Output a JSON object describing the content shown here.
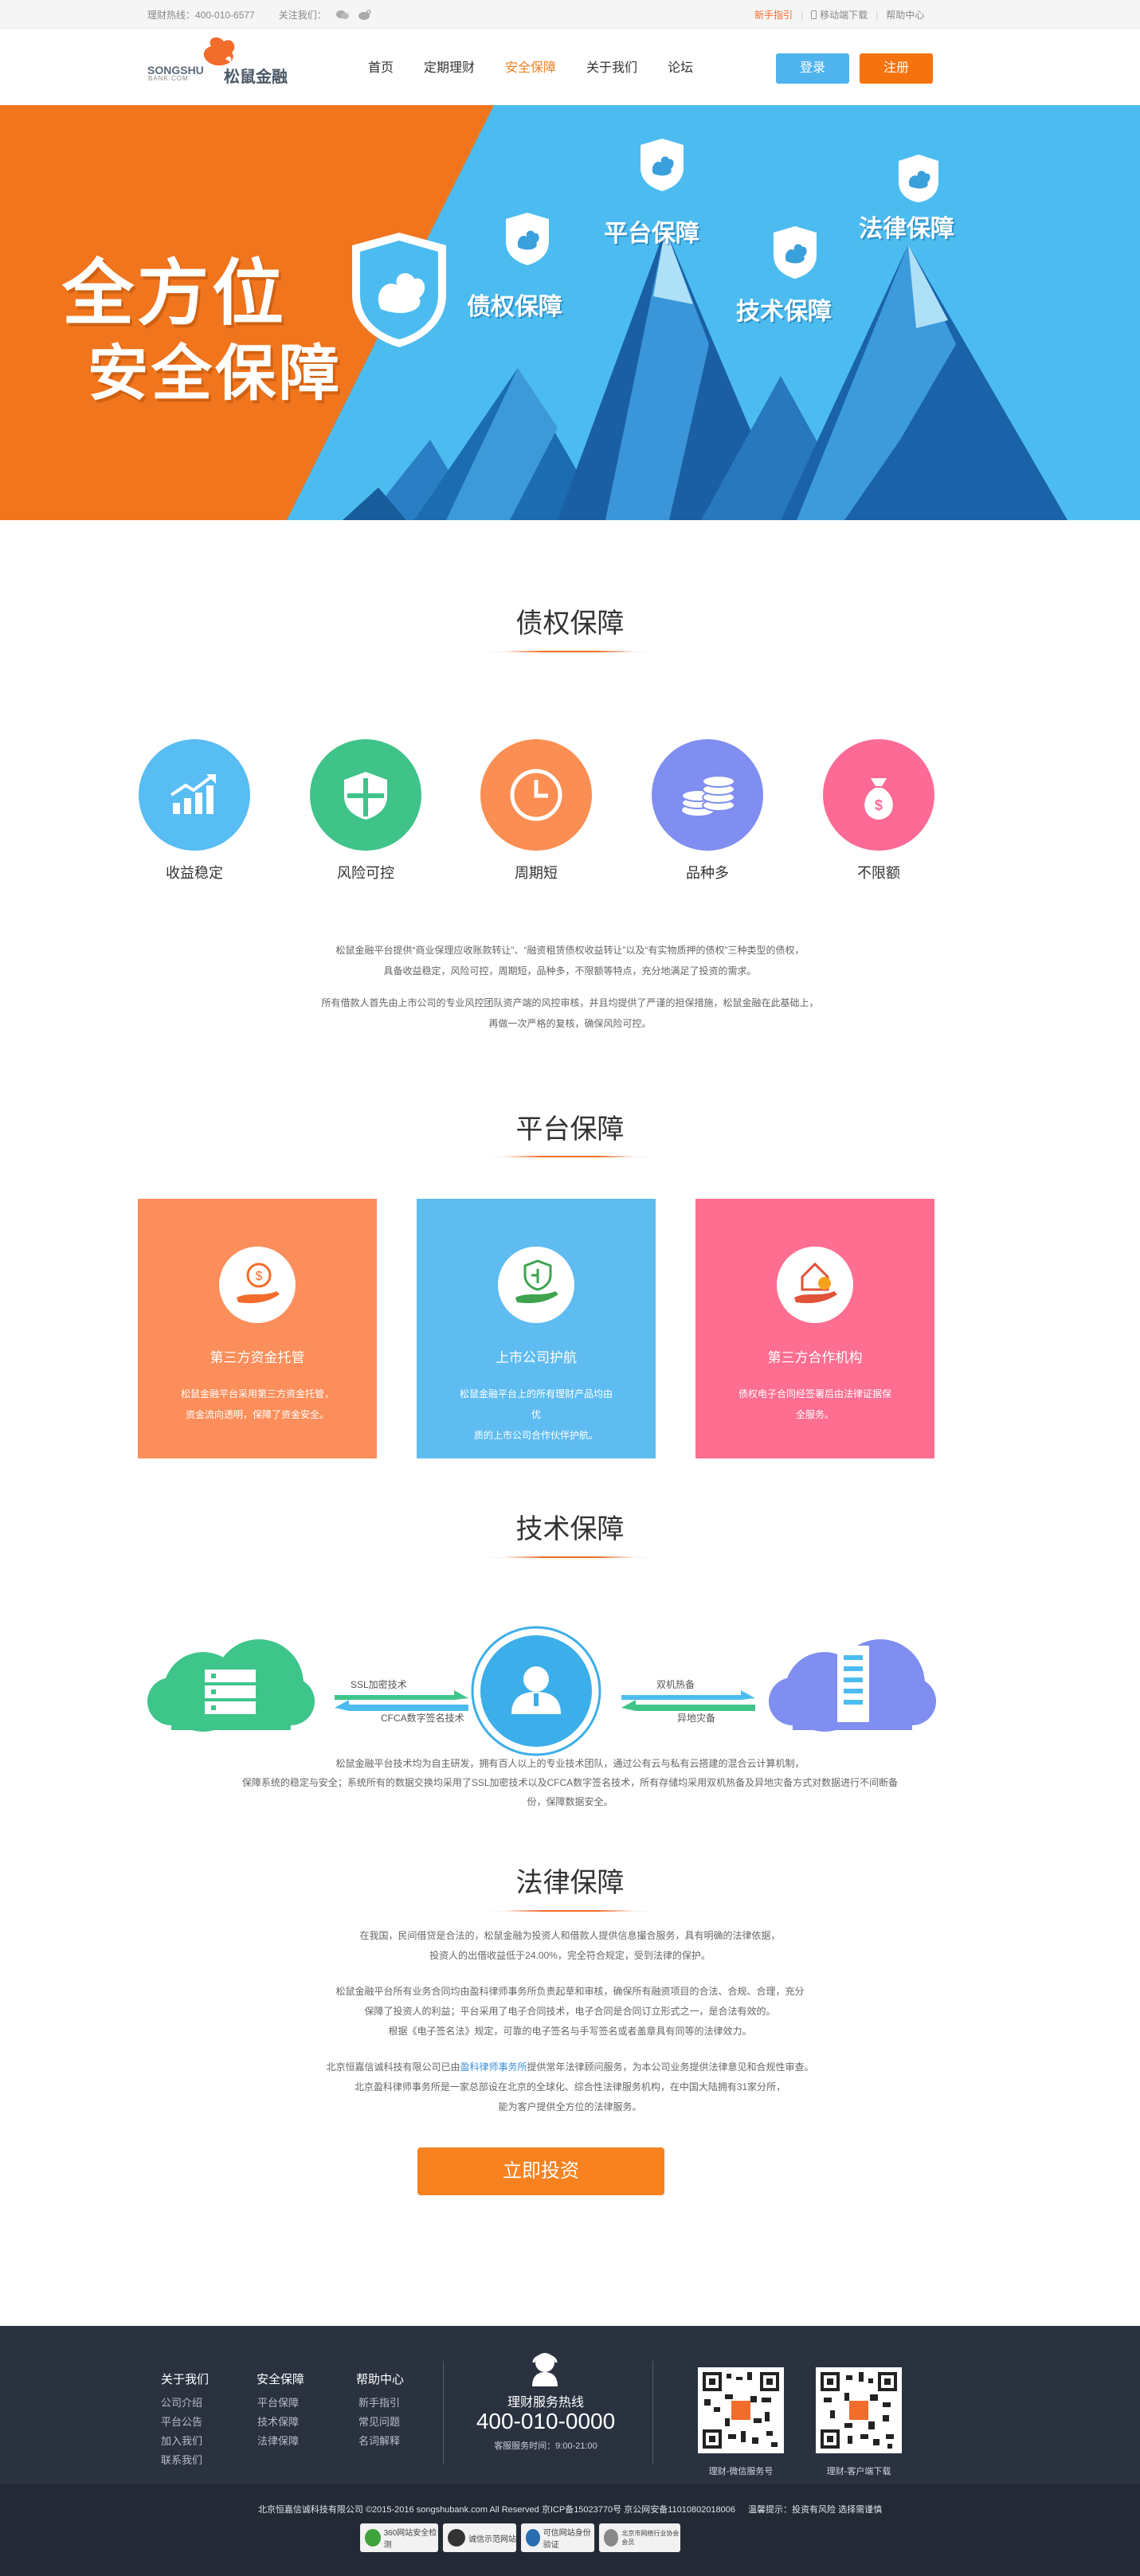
{
  "topbar": {
    "hotline": "理财热线：400-010-6577",
    "follow": "关注我们：",
    "newbie": "新手指引",
    "mobile": "移动端下载",
    "help": "帮助中心"
  },
  "header": {
    "logo_en": "SONGSHU",
    "logo_sub": "BANK.COM",
    "logo_cn": "松鼠金融",
    "nav": [
      "首页",
      "定期理财",
      "安全保障",
      "关于我们",
      "论坛"
    ],
    "login": "登录",
    "register": "注册"
  },
  "banner": {
    "title1": "全方位",
    "title2": "安全保障",
    "labels": [
      "债权保障",
      "平台保障",
      "技术保障",
      "法律保障"
    ]
  },
  "debt": {
    "title": "债权保障",
    "features": [
      "收益稳定",
      "风险可控",
      "周期短",
      "品种多",
      "不限额"
    ],
    "p1": "松鼠金融平台提供“商业保理应收账款转让”、“融资租赁债权收益转让”以及“有实物质押的债权”三种类型的债权，",
    "p2": "具备收益稳定，风险可控，周期短，品种多，不限额等特点，充分地满足了投资的需求。",
    "p3": "所有借款人首先由上市公司的专业风控团队资产端的风控审核，并且均提供了严谨的担保措施，松鼠金融在此基础上，",
    "p4": "再做一次严格的复核，确保风险可控。"
  },
  "platform": {
    "title": "平台保障",
    "boxes": [
      {
        "title": "第三方资金托管",
        "d1": "松鼠金融平台采用第三方资金托管，",
        "d2": "资金流向透明，保障了资金安全。"
      },
      {
        "title": "上市公司护航",
        "d1": "松鼠金融平台上的所有理财产品均由优",
        "d2": "质的上市公司合作伙伴护航。"
      },
      {
        "title": "第三方合作机构",
        "d1": "债权电子合同经签署后由法律证据保全服务。",
        "d2": ""
      }
    ]
  },
  "tech": {
    "title": "技术保障",
    "ssl": "SSL加密技术",
    "cfca": "CFCA数字签名技术",
    "backup": "双机热备",
    "remote": "异地灾备",
    "p1": "松鼠金融平台技术均为自主研发，拥有百人以上的专业技术团队，通过公有云与私有云搭建的混合云计算机制，",
    "p2": "保障系统的稳定与安全；系统所有的数据交换均采用了SSL加密技术以及CFCA数字签名技术，所有存储均采用双机热备及异地灾备方式对数据进行不间断备",
    "p3": "份，保障数据安全。"
  },
  "law": {
    "title": "法律保障",
    "p1": "在我国，民间借贷是合法的，松鼠金融为投资人和借款人提供信息撮合服务，具有明确的法律依据，",
    "p2": "投资人的出借收益低于24.00%，完全符合规定，受到法律的保护。",
    "p3": "松鼠金融平台所有业务合同均由盈科律师事务所负责起草和审核，确保所有融资项目的合法、合规、合理，充分",
    "p4": "保障了投资人的利益；平台采用了电子合同技术，电子合同是合同订立形式之一，是合法有效的。",
    "p5": "根据《电子签名法》规定，可靠的电子签名与手写签名或者盖章具有同等的法律效力。",
    "p6a": "北京恒嘉信诚科技有限公司已由",
    "p6link": "盈科律师事务所",
    "p6b": "提供常年法律顾问服务，为本公司业务提供法律意见和合规性审查。",
    "p7": "北京盈科律师事务所是一家总部设在北京的全球化、综合性法律服务机构，在中国大陆拥有31家分所，",
    "p8": "能为客户提供全方位的法律服务。",
    "cta": "立即投资"
  },
  "footer": {
    "cols": [
      {
        "h": "关于我们",
        "items": [
          "公司介绍",
          "平台公告",
          "加入我们",
          "联系我们"
        ]
      },
      {
        "h": "安全保障",
        "items": [
          "平台保障",
          "技术保障",
          "法律保障"
        ]
      },
      {
        "h": "帮助中心",
        "items": [
          "新手指引",
          "常见问题",
          "名词解释"
        ]
      }
    ],
    "hotline_label": "理财服务热线",
    "hotline": "400-010-0000",
    "hours": "客服服务时间：9:00-21:00",
    "qr1": "理财-微信服务号",
    "qr2": "理财-客户端下载",
    "copyright": "北京恒嘉信诚科技有限公司 ©2015-2016 songshubank.com All Reserved 京ICP备15023770号 京公网安备11010802018006",
    "notice": "温馨提示：投资有风险 选择需谨慎",
    "badges": [
      "360网站安全检测",
      "诚信示范网站",
      "可信网站身份验证",
      "北京市网络行业协会会员"
    ]
  }
}
